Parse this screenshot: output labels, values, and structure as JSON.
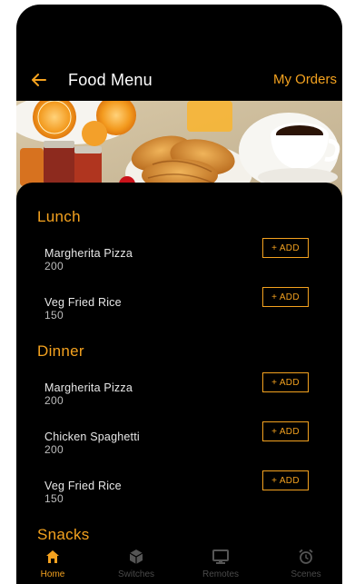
{
  "header": {
    "title": "Food Menu",
    "my_orders_label": "My Orders"
  },
  "colors": {
    "accent": "#f4a21f",
    "background": "#000000",
    "text": "#e8e8e8",
    "inactive_tab": "#4a4a4a"
  },
  "sections": [
    {
      "title": "Lunch",
      "items": [
        {
          "name": "Margherita Pizza",
          "price": "200",
          "action": "+ ADD"
        },
        {
          "name": "Veg Fried Rice",
          "price": "150",
          "action": "+ ADD"
        }
      ]
    },
    {
      "title": "Dinner",
      "items": [
        {
          "name": "Margherita Pizza",
          "price": "200",
          "action": "+ ADD"
        },
        {
          "name": "Chicken Spaghetti",
          "price": "200",
          "action": "+ ADD"
        },
        {
          "name": "Veg Fried Rice",
          "price": "150",
          "action": "+ ADD"
        }
      ]
    },
    {
      "title": "Snacks",
      "items": []
    }
  ],
  "tabs": [
    {
      "label": "Home",
      "icon": "home-icon",
      "active": true
    },
    {
      "label": "Switches",
      "icon": "cube-icon",
      "active": false
    },
    {
      "label": "Remotes",
      "icon": "monitor-icon",
      "active": false
    },
    {
      "label": "Scenes",
      "icon": "alarm-clock-icon",
      "active": false
    }
  ]
}
